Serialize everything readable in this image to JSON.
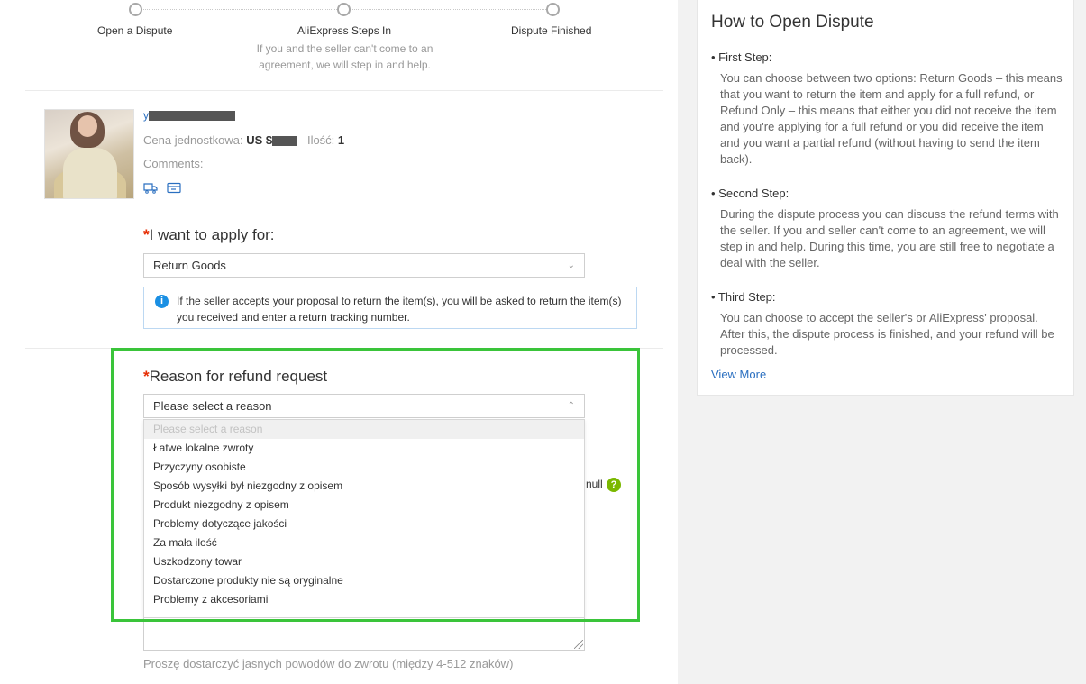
{
  "steps": [
    {
      "label": "Open a Dispute"
    },
    {
      "label": "AliExpress Steps In",
      "description": "If you and the seller can't come to an agreement, we will step in and help."
    },
    {
      "label": "Dispute Finished"
    }
  ],
  "product": {
    "title_visible": "y",
    "unit_price_label": "Cena jednostkowa:",
    "currency": "US $",
    "quantity_label": "Ilość:",
    "quantity": "1",
    "comments_label": "Comments:"
  },
  "apply_for": {
    "label": "I want to apply for:",
    "required_mark": "*",
    "selected": "Return Goods",
    "info": "If the seller accepts your proposal to return the item(s), you will be asked to return the item(s) you received and enter a return tracking number."
  },
  "reason": {
    "label": "Reason for refund request",
    "required_mark": "*",
    "selected": "Please select a reason",
    "options": [
      "Please select a reason",
      "Łatwe lokalne zwroty",
      "Przyczyny osobiste",
      "Sposób wysyłki był niezgodny z opisem",
      "Produkt niezgodny z opisem",
      "Problemy dotyczące jakości",
      "Za mała ilość",
      "Uszkodzony towar",
      "Dostarczone produkty nie są oryginalne",
      "Problemy z akcesoriami"
    ],
    "null_text": "null",
    "hint": "Proszę dostarczyć jasnych powodów do zwrotu (między 4-512 znaków)"
  },
  "colors": {
    "highlight": "#3ac43a",
    "link": "#2a6fc0",
    "required": "#e62e04",
    "info": "#1a8fe3"
  },
  "sidebar": {
    "title": "How to Open Dispute",
    "steps": [
      {
        "heading": "• First Step:",
        "text": "You can choose between two options: Return Goods – this means that you want to return the item and apply for a full refund, or Refund Only – this means that either you did not receive the item and you're applying for a full refund or you did receive the item and you want a partial refund (without having to send the item back)."
      },
      {
        "heading": "• Second Step:",
        "text": "During the dispute process you can discuss the refund terms with the seller. If you and seller can't come to an agreement, we will step in and help. During this time, you are still free to negotiate a deal with the seller."
      },
      {
        "heading": "• Third Step:",
        "text": "You can choose to accept the seller's or AliExpress' proposal. After this, the dispute process is finished, and your refund will be processed."
      }
    ],
    "view_more": "View More"
  }
}
